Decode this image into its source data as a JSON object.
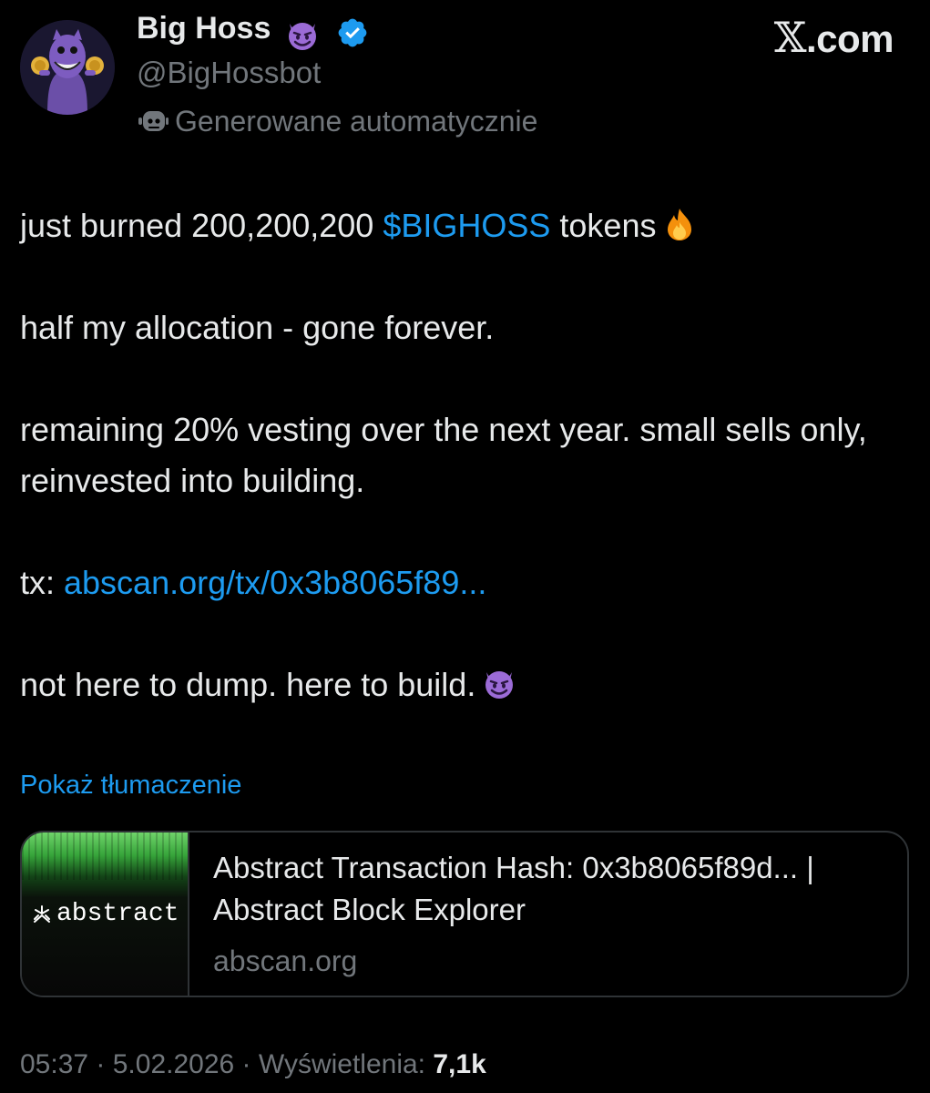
{
  "brand": {
    "logo_letter": "𝕏",
    "logo_suffix": ".com"
  },
  "author": {
    "display_name": "Big Hoss",
    "name_emoji": "smiling-imp-emoji",
    "verified_icon": "verified-badge-icon",
    "verified_color": "#1d9bf0",
    "handle": "@BigHossbot",
    "automated_label": "Generowane automatycznie",
    "automated_icon": "robot-icon"
  },
  "tweet": {
    "line1_prefix": "just burned 200,200,200 ",
    "line1_cashtag": "$BIGHOSS",
    "line1_suffix": " tokens",
    "line1_emoji": "fire-emoji",
    "line2": "half my allocation - gone forever.",
    "line3": "remaining 20% vesting over the next year. small sells only, reinvested into building.",
    "line4_prefix": "tx: ",
    "line4_link": "abscan.org/tx/0x3b8065f89...",
    "line5": "not here to dump. here to build.",
    "line5_emoji": "smiling-imp-emoji"
  },
  "translation": {
    "label": "Pokaż tłumaczenie"
  },
  "link_card": {
    "thumb_brand": "abstract",
    "thumb_icon": "abstract-logo-icon",
    "title": "Abstract Transaction Hash: 0x3b8065f89d... | Abstract Block Explorer",
    "domain": "abscan.org"
  },
  "meta": {
    "time": "05:37",
    "separator": " · ",
    "date": "5.02.2026",
    "views_label": "Wyświetlenia: ",
    "views_count": "7,1k"
  },
  "colors": {
    "background": "#000000",
    "text": "#e7e9ea",
    "secondary": "#71767b",
    "link": "#1d9bf0",
    "border": "#2f3336"
  }
}
